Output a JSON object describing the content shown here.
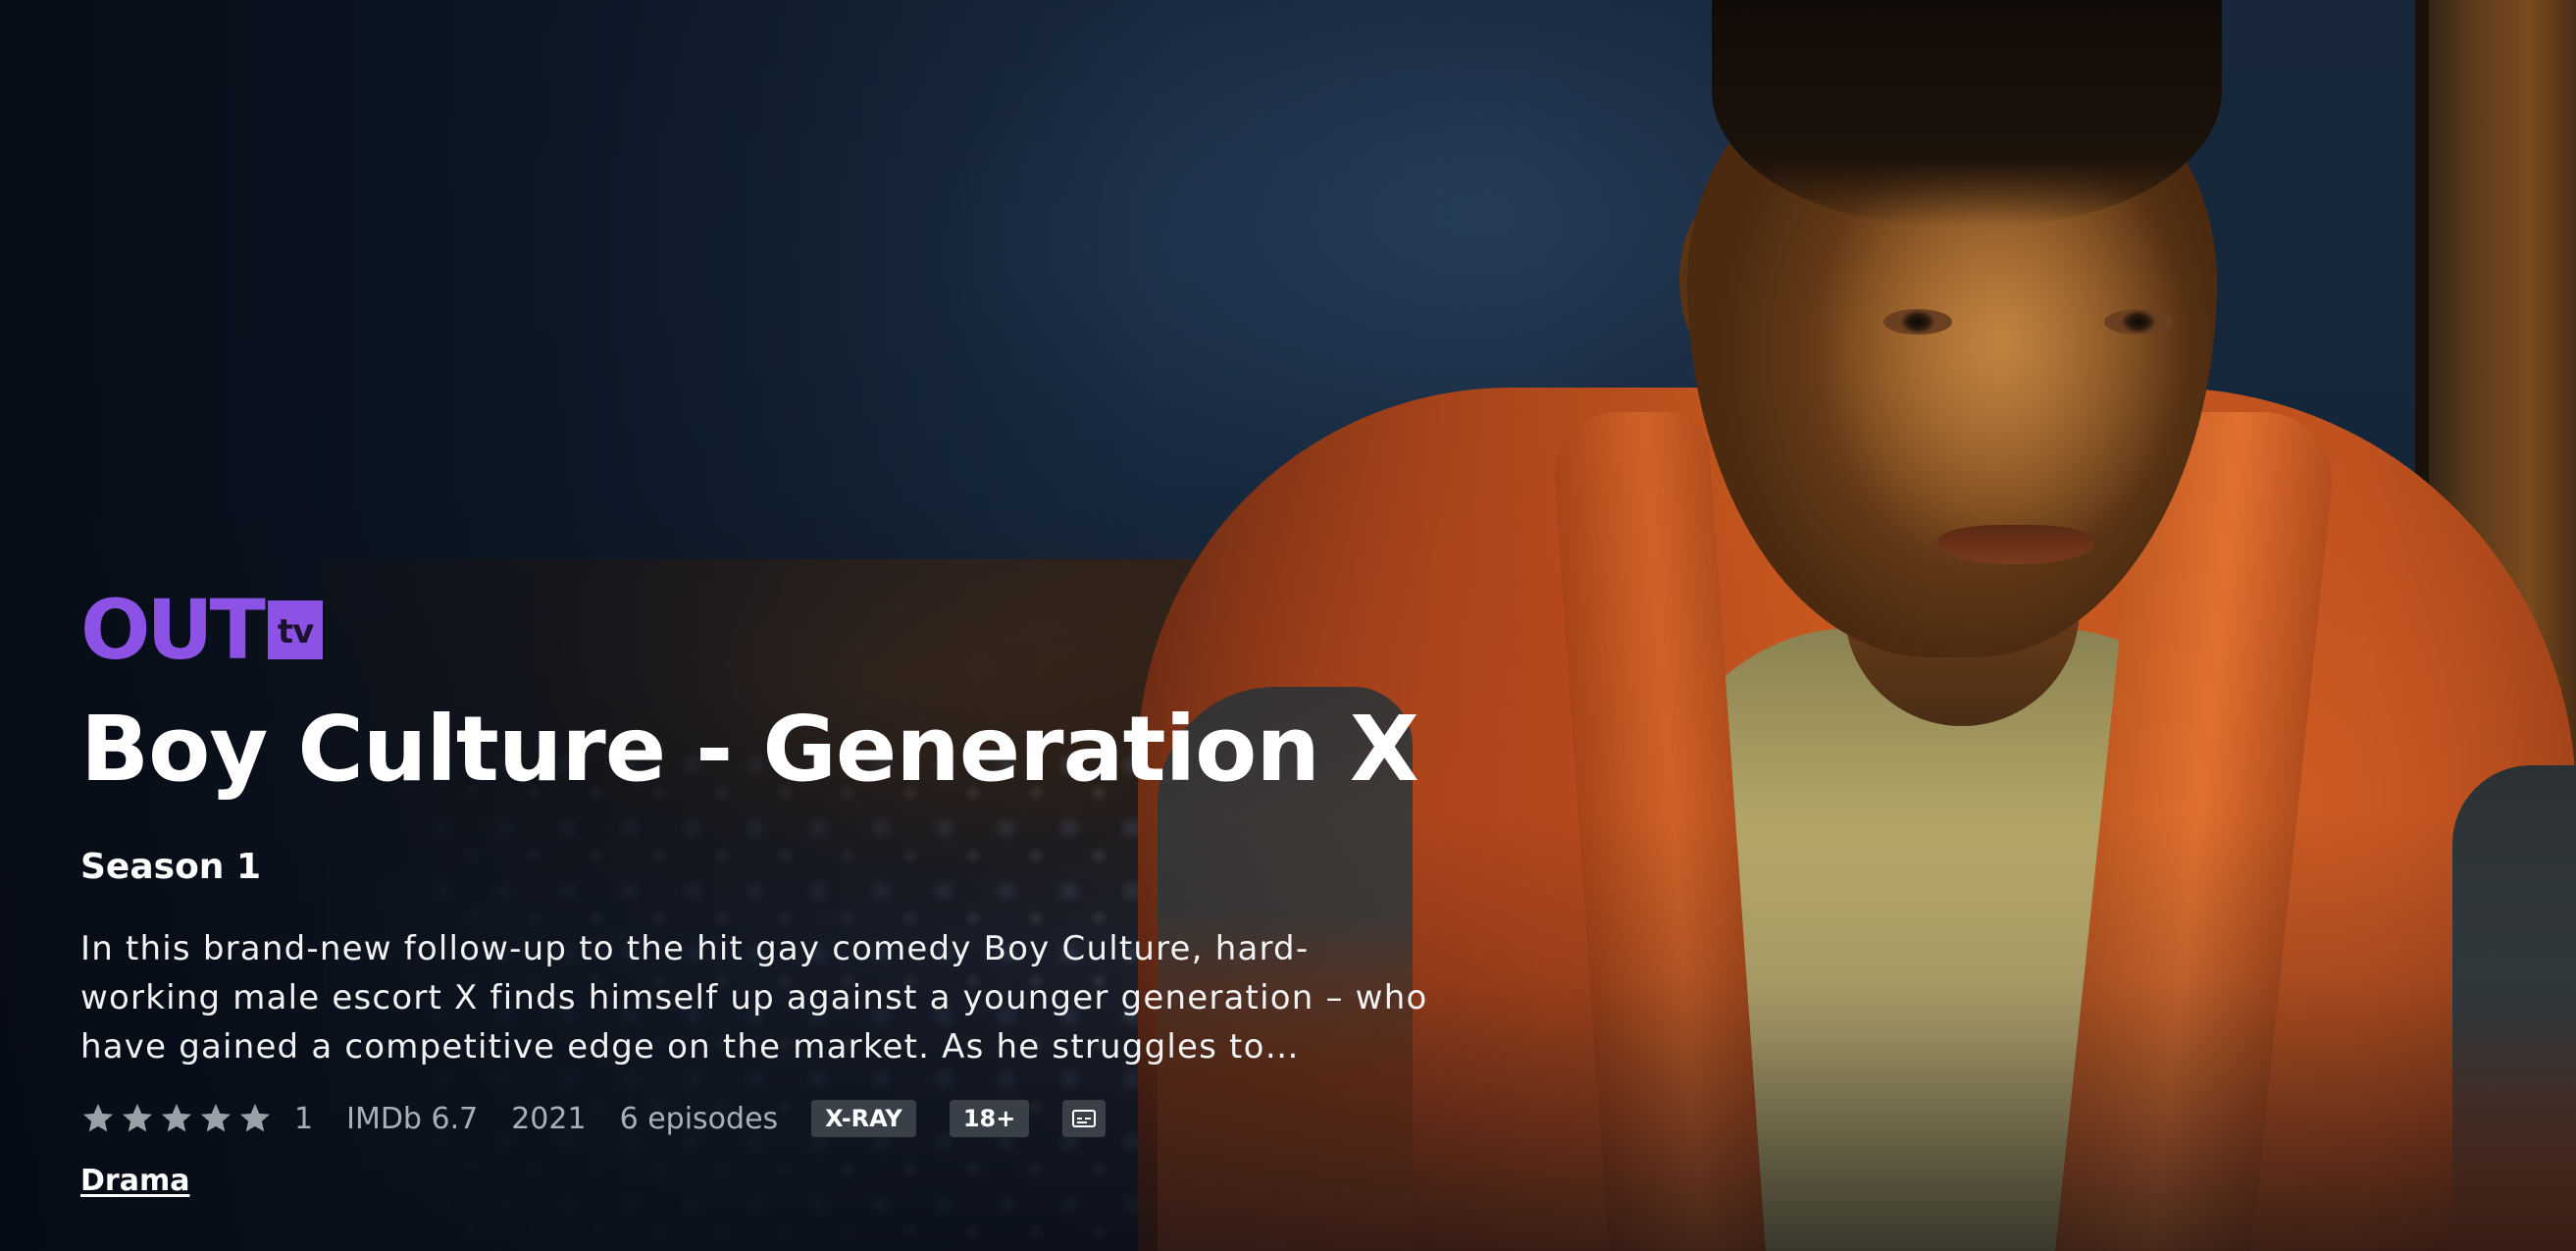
{
  "provider": {
    "logo_text": "OUT",
    "logo_suffix": "tv",
    "brand_color": "#8c52e6"
  },
  "show": {
    "title": "Boy Culture - Generation X",
    "season": "Season 1",
    "synopsis": "In this brand-new follow-up to the hit gay comedy Boy Culture, hard-working male escort X finds himself up against a younger generation – who have gained a competitive edge on the market. As he struggles to…"
  },
  "meta": {
    "star_rating": 5,
    "star_max": 5,
    "rating_count": "1",
    "imdb": "IMDb 6.7",
    "year": "2021",
    "episodes": "6 episodes",
    "xray_badge": "X-RAY",
    "age_badge": "18+",
    "subtitles_icon": "subtitles-icon"
  },
  "genre": {
    "label": "Drama"
  }
}
